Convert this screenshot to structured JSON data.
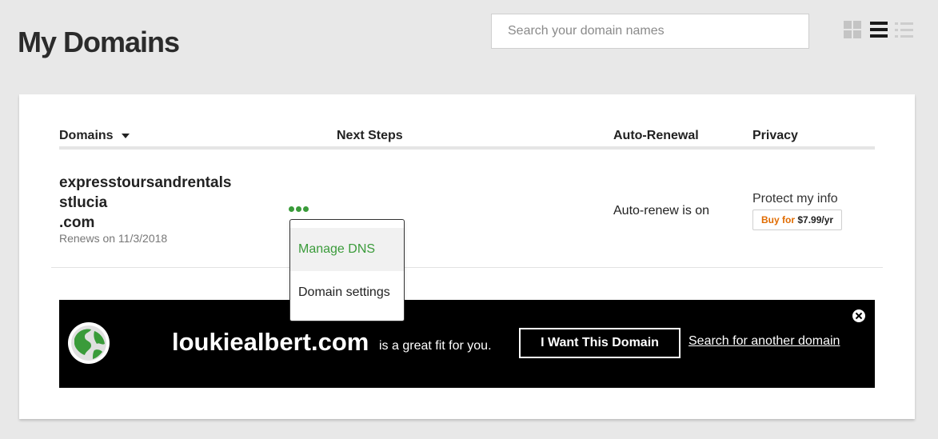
{
  "header": {
    "title": "My Domains",
    "search_placeholder": "Search your domain names"
  },
  "view_toggles": {
    "icons": [
      "grid-view-icon",
      "list-view-icon",
      "detail-list-view-icon"
    ],
    "active": "list-view-icon"
  },
  "table": {
    "columns": [
      "Domains",
      "Next Steps",
      "Auto-Renewal",
      "Privacy"
    ],
    "sort_column": "Domains",
    "rows": [
      {
        "domain_lines": [
          "expresstoursandrentals",
          "stlucia",
          ".com"
        ],
        "renews": "Renews on 11/3/2018",
        "auto_renewal": "Auto-renew is on",
        "privacy_label": "Protect my info",
        "buy_for": "Buy for",
        "buy_price": "$7.99/yr"
      }
    ]
  },
  "next_steps_menu": {
    "items": [
      "Manage DNS",
      "Domain settings"
    ],
    "highlighted": "Manage DNS"
  },
  "promo": {
    "domain": "loukiealbert.com",
    "tagline": "is a great fit for you.",
    "cta": "I Want This Domain",
    "link": "Search for another domain"
  },
  "colors": {
    "accent_green": "#3a9b3a",
    "buy_orange": "#e06b00",
    "background": "#e8e8e8",
    "promo_background": "#000000"
  }
}
